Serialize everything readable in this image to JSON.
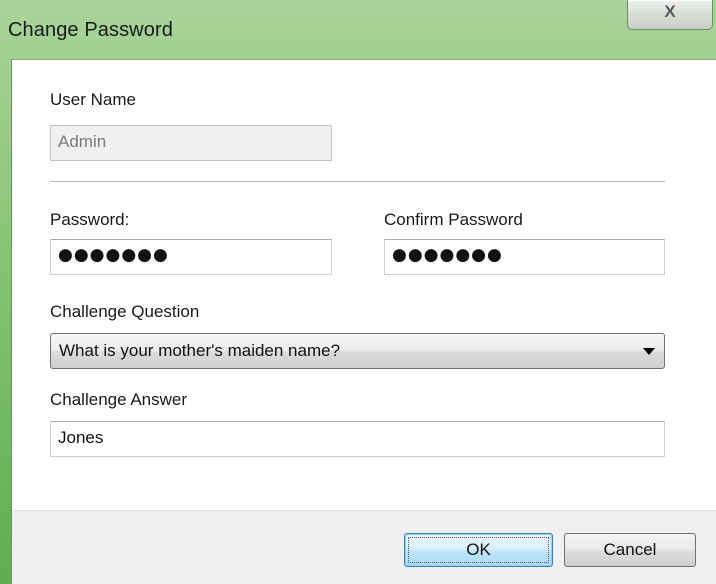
{
  "window": {
    "title": "Change Password",
    "close_glyph": "X"
  },
  "form": {
    "user_name": {
      "label": "User Name",
      "value": "Admin",
      "disabled": true
    },
    "password": {
      "label": "Password:",
      "value": "●●●●●●●"
    },
    "confirm_password": {
      "label": "Confirm Password",
      "value": "●●●●●●●"
    },
    "challenge_question": {
      "label": "Challenge Question",
      "selected": "What is your mother's maiden name?"
    },
    "challenge_answer": {
      "label": "Challenge Answer",
      "value": "Jones"
    }
  },
  "buttons": {
    "ok": "OK",
    "cancel": "Cancel"
  },
  "icons": {
    "close": "close-icon",
    "dropdown": "chevron-down-icon"
  },
  "colors": {
    "titlebar": "#7fc06c",
    "default_button_border": "#3c7fb1",
    "dialog_background": "#ffffff",
    "footer_background": "#f0f0f0"
  }
}
